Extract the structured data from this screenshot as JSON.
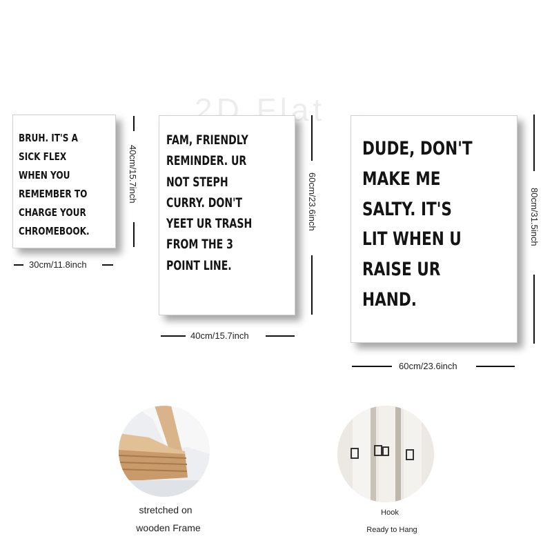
{
  "watermark": "2D Flat",
  "posters": [
    {
      "text": "Bruh. it's a\nsick flex\nwhen you\nremember to\ncharge your\nChromebook.",
      "width_label": "30cm/11.8inch",
      "height_label": "40cm/15.7inch"
    },
    {
      "text": "Fam, friendly\nreminder. Ur\nnot Steph\nCurry. Don't\nyeet ur trash\nfrom the 3\npoint line.",
      "width_label": "40cm/15.7inch",
      "height_label": "60cm/23.6inch"
    },
    {
      "text": "Dude, don't\nmake me\nsalty. it's\nlit when u\nraise ur\nhand.",
      "width_label": "60cm/23.6inch",
      "height_label": "80cm/31.5inch"
    }
  ],
  "features": [
    {
      "line1": "stretched on",
      "line2": "wooden Frame"
    },
    {
      "line1": "Hook",
      "line2": "Ready to Hang"
    }
  ],
  "colors": {
    "background": "#ffffff",
    "text": "#111111",
    "wood": "#d9b48a"
  }
}
